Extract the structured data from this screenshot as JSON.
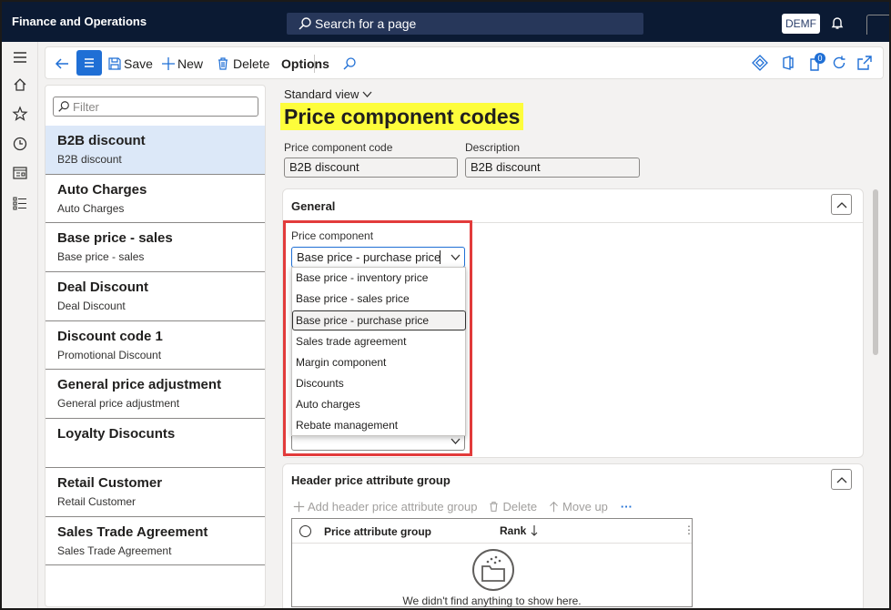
{
  "header": {
    "app_title": "Finance and Operations",
    "search_placeholder": "Search for a page",
    "company": "DEMF"
  },
  "actions": {
    "save": "Save",
    "new": "New",
    "delete": "Delete",
    "options": "Options",
    "badge_count": "0"
  },
  "list": {
    "filter_placeholder": "Filter",
    "items": [
      {
        "title": "B2B discount",
        "subtitle": "B2B discount"
      },
      {
        "title": "Auto Charges",
        "subtitle": "Auto Charges"
      },
      {
        "title": "Base price - sales",
        "subtitle": "Base price - sales"
      },
      {
        "title": "Deal Discount",
        "subtitle": "Deal Discount"
      },
      {
        "title": "Discount code 1",
        "subtitle": "Promotional Discount"
      },
      {
        "title": "General price adjustment",
        "subtitle": "General price adjustment"
      },
      {
        "title": "Loyalty Disocunts",
        "subtitle": ""
      },
      {
        "title": "Retail Customer",
        "subtitle": "Retail Customer"
      },
      {
        "title": "Sales Trade Agreement",
        "subtitle": "Sales Trade Agreement"
      }
    ]
  },
  "main": {
    "view": "Standard view",
    "title": "Price component codes",
    "code_label": "Price component code",
    "code_value": "B2B discount",
    "desc_label": "Description",
    "desc_value": "B2B discount"
  },
  "general": {
    "title": "General",
    "price_component_label": "Price component",
    "price_component_value": "Base price - purchase price",
    "options": [
      "Base price - inventory price",
      "Base price - sales price",
      "Base price - purchase price",
      "Sales trade agreement",
      "Margin component",
      "Discounts",
      "Auto charges",
      "Rebate management"
    ]
  },
  "header_group": {
    "title": "Header price attribute group",
    "add": "Add header price attribute group",
    "delete": "Delete",
    "move_up": "Move up",
    "more": "···",
    "col_group": "Price attribute group",
    "col_rank": "Rank",
    "empty": "We didn't find anything to show here."
  },
  "colors": {
    "topbar": "#0b1a33",
    "accent": "#1f6fd5",
    "highlight": "#fdfd3b",
    "callout": "#e23b3b"
  }
}
